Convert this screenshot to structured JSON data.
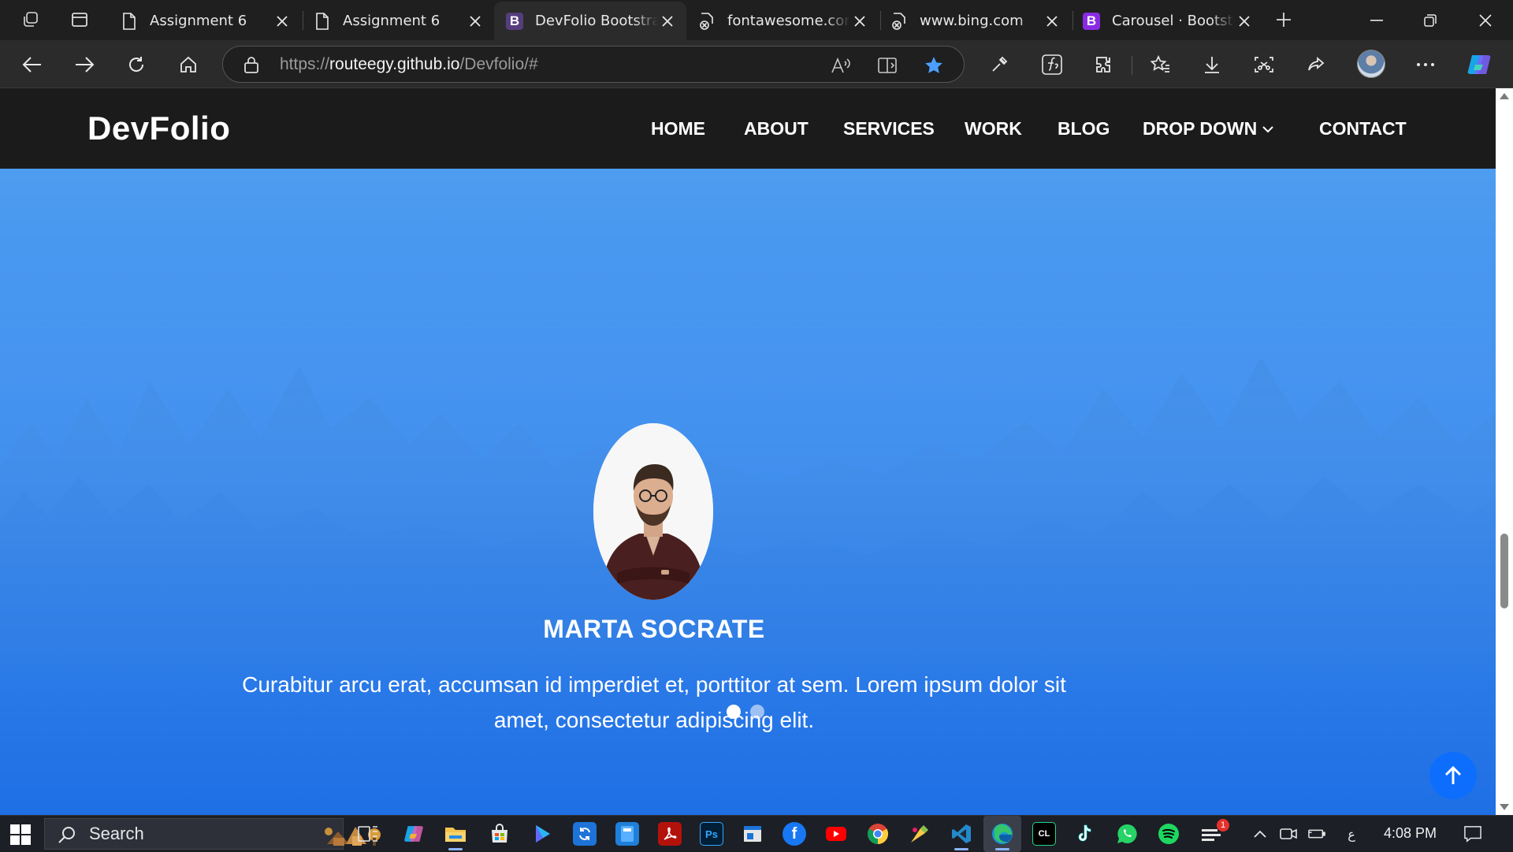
{
  "browser": {
    "tabs": [
      {
        "title": "Assignment 6",
        "favicon": "document-icon",
        "active": false
      },
      {
        "title": "Assignment 6",
        "favicon": "document-icon",
        "active": false
      },
      {
        "title": "DevFolio Bootstrap",
        "favicon": "bootstrap-b-icon",
        "favicon_color": "#563d7c",
        "active": true
      },
      {
        "title": "fontawesome.com",
        "favicon": "blocked-page-icon",
        "active": false
      },
      {
        "title": "www.bing.com",
        "favicon": "blocked-page-icon",
        "active": false
      },
      {
        "title": "Carousel · Bootstrap",
        "favicon": "bootstrap-b-icon",
        "favicon_color": "#7952b3",
        "active": false
      }
    ],
    "favicon_letter": "B",
    "url_scheme": "https://",
    "url_host": "routeegy.github.io",
    "url_path": "/Devfolio/#",
    "favorite_starred": true,
    "accent_star_color": "#4ba0ff"
  },
  "site": {
    "brand": "DevFolio",
    "nav": [
      "HOME",
      "ABOUT",
      "SERVICES",
      "WORK",
      "BLOG",
      "DROP DOWN",
      "CONTACT"
    ],
    "testimonial": {
      "name": "MARTA SOCRATE",
      "quote": "Curabitur arcu erat, accumsan id imperdiet et, porttitor at sem. Lorem ipsum dolor sit amet, consectetur adipiscing elit."
    },
    "carousel": {
      "slides": 2,
      "active_index": 0
    },
    "colors": {
      "header_bg": "#1b1b1b",
      "hero_top": "#4d9cf0",
      "hero_bottom": "#1f6fe5",
      "back_to_top": "#0d6efd"
    }
  },
  "taskbar": {
    "search_label": "Search",
    "clock": "4:08 PM",
    "notification_count": "1",
    "input_indicator": "ع",
    "apps": [
      {
        "name": "task-view-icon"
      },
      {
        "name": "copilot-icon",
        "letters": ""
      },
      {
        "name": "file-explorer-icon"
      },
      {
        "name": "microsoft-store-icon"
      },
      {
        "name": "media-player-icon"
      },
      {
        "name": "sync-app-icon"
      },
      {
        "name": "calculator-icon"
      },
      {
        "name": "acrobat-icon"
      },
      {
        "name": "photoshop-icon",
        "letters": "Ps"
      },
      {
        "name": "window-app-icon"
      },
      {
        "name": "facebook-icon",
        "letters": "f"
      },
      {
        "name": "youtube-icon"
      },
      {
        "name": "chrome-icon"
      },
      {
        "name": "paint-icon"
      },
      {
        "name": "vscode-icon"
      },
      {
        "name": "edge-icon"
      },
      {
        "name": "clion-icon",
        "letters": "CL"
      },
      {
        "name": "tiktok-icon"
      },
      {
        "name": "whatsapp-icon"
      },
      {
        "name": "spotify-icon"
      },
      {
        "name": "settings-app-icon"
      }
    ]
  }
}
